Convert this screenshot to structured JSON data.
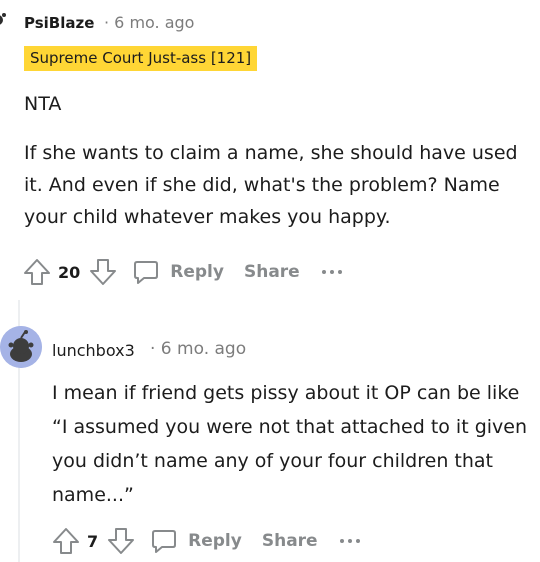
{
  "comments": [
    {
      "author": "PsiBlaze",
      "time_meta": "· 6 mo. ago",
      "flair": "Supreme Court Just-ass [121]",
      "paragraphs": [
        "NTA",
        "If she wants to claim a name, she should have used it. And even if she did, what's the problem? Name your child whatever makes you happy."
      ],
      "score": "20",
      "reply_label": "Reply",
      "share_label": "Share"
    },
    {
      "author": "lunchbox3",
      "time_meta": "· 6 mo. ago",
      "paragraphs": [
        "I mean if friend gets pissy about it OP can be like “I assumed you were not that attached to it given you didn’t name any of your four children that name...”"
      ],
      "score": "7",
      "reply_label": "Reply",
      "share_label": "Share"
    }
  ],
  "icons": {
    "upvote": "upvote-arrow-icon",
    "downvote": "downvote-arrow-icon",
    "reply": "speech-bubble-icon",
    "more": "more-dots-icon",
    "avatar": "snoo-avatar-icon"
  },
  "colors": {
    "flair_bg": "#ffd635",
    "meta_gray": "#7c7c7c",
    "action_gray": "#878a8c",
    "avatar_bg": "#a5b3e6",
    "thread_line": "#edeff1"
  }
}
